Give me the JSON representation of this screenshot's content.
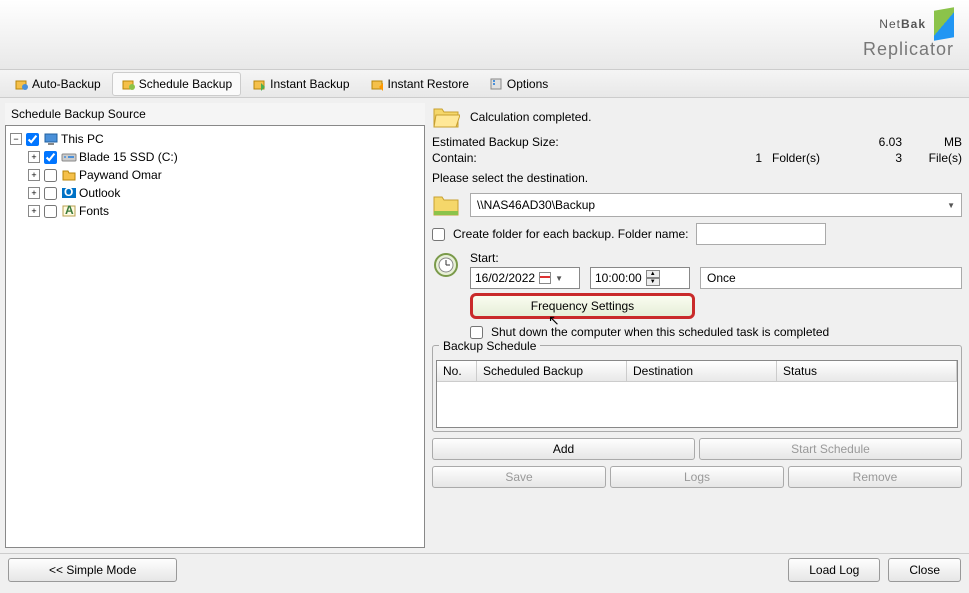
{
  "app": {
    "logo_net": "Net",
    "logo_bak": "Bak",
    "logo_sub": "Replicator"
  },
  "tabs": {
    "auto": "Auto-Backup",
    "sched": "Schedule Backup",
    "instant": "Instant Backup",
    "restore": "Instant Restore",
    "options": "Options"
  },
  "left": {
    "title": "Schedule Backup Source",
    "tree": {
      "pc": "This PC",
      "drive": "Blade 15 SSD (C:)",
      "user": "Paywand Omar",
      "outlook": "Outlook",
      "fonts": "Fonts"
    }
  },
  "right": {
    "calc": "Calculation completed.",
    "est_label": "Estimated Backup Size:",
    "est_val": "6.03",
    "est_unit": "MB",
    "contain_label": "Contain:",
    "folders_n": "1",
    "folders_l": "Folder(s)",
    "files_n": "3",
    "files_l": "File(s)",
    "dest_label": "Please select the destination.",
    "dest_value": "\\\\NAS46AD30\\Backup",
    "create_folder": "Create folder for each backup. Folder name:",
    "start_label": "Start:",
    "date": "16/02/2022",
    "time": "10:00:00",
    "freq": "Once",
    "freq_btn": "Frequency Settings",
    "shutdown": "Shut down the computer when this scheduled task is completed",
    "schedule_label": "Backup Schedule",
    "cols": {
      "no": "No.",
      "sb": "Scheduled Backup",
      "dest": "Destination",
      "status": "Status"
    },
    "btns": {
      "add": "Add",
      "start": "Start Schedule",
      "save": "Save",
      "logs": "Logs",
      "remove": "Remove"
    }
  },
  "footer": {
    "simple": "<< Simple Mode",
    "load": "Load Log",
    "close": "Close"
  }
}
